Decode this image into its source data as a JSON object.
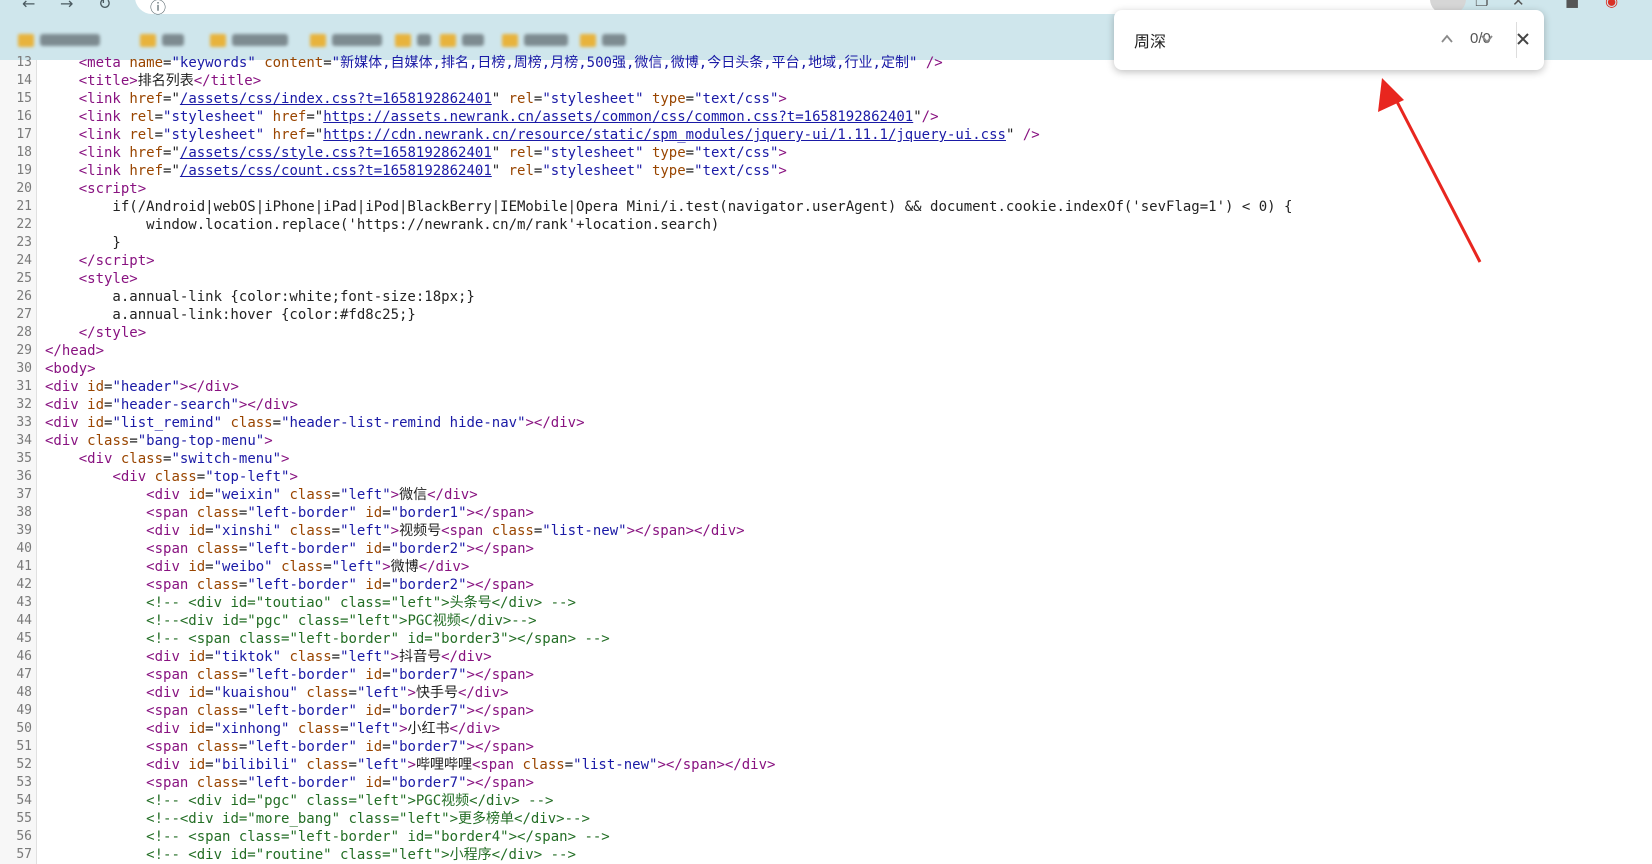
{
  "find_bar": {
    "query": "周深",
    "match_count": "0/0"
  },
  "icons": {
    "find_prev": "chevron-up-icon",
    "find_next": "chevron-down-icon",
    "find_close": "close-icon"
  },
  "code_lines": [
    {
      "n": "13",
      "html": "    <span class=\"tag\">&lt;meta</span> <span class=\"attr\">name</span>=<span class=\"val\">\"keywords\"</span> <span class=\"attr\">content</span>=<span class=\"val\">\"新媒体,自媒体,排名,日榜,周榜,月榜,500强,微信,微博,今日头条,平台,地域,行业,定制\"</span> <span class=\"tag\">/&gt;</span>"
    },
    {
      "n": "14",
      "html": "    <span class=\"tag\">&lt;title&gt;</span>排名列表<span class=\"tag\">&lt;/title&gt;</span>"
    },
    {
      "n": "15",
      "html": "    <span class=\"tag\">&lt;link</span> <span class=\"attr\">href</span>=\"<span class=\"link\">/assets/css/index.css?t=1658192862401</span>\" <span class=\"attr\">rel</span>=<span class=\"val\">\"stylesheet\"</span> <span class=\"attr\">type</span>=<span class=\"val\">\"text/css\"</span><span class=\"tag\">&gt;</span>"
    },
    {
      "n": "16",
      "html": "    <span class=\"tag\">&lt;link</span> <span class=\"attr\">rel</span>=<span class=\"val\">\"stylesheet\"</span> <span class=\"attr\">href</span>=\"<span class=\"link\">https://assets.newrank.cn/assets/common/css/common.css?t=1658192862401</span>\"<span class=\"tag\">/&gt;</span>"
    },
    {
      "n": "17",
      "html": "    <span class=\"tag\">&lt;link</span> <span class=\"attr\">rel</span>=<span class=\"val\">\"stylesheet\"</span> <span class=\"attr\">href</span>=\"<span class=\"link\">https://cdn.newrank.cn/resource/static/spm_modules/jquery-ui/1.11.1/jquery-ui.css</span>\" <span class=\"tag\">/&gt;</span>"
    },
    {
      "n": "18",
      "html": "    <span class=\"tag\">&lt;link</span> <span class=\"attr\">href</span>=\"<span class=\"link\">/assets/css/style.css?t=1658192862401</span>\" <span class=\"attr\">rel</span>=<span class=\"val\">\"stylesheet\"</span> <span class=\"attr\">type</span>=<span class=\"val\">\"text/css\"</span><span class=\"tag\">&gt;</span>"
    },
    {
      "n": "19",
      "html": "    <span class=\"tag\">&lt;link</span> <span class=\"attr\">href</span>=\"<span class=\"link\">/assets/css/count.css?t=1658192862401</span>\" <span class=\"attr\">rel</span>=<span class=\"val\">\"stylesheet\"</span> <span class=\"attr\">type</span>=<span class=\"val\">\"text/css\"</span><span class=\"tag\">&gt;</span>"
    },
    {
      "n": "20",
      "html": "    <span class=\"tag\">&lt;script&gt;</span>"
    },
    {
      "n": "21",
      "html": "        if(/Android|webOS|iPhone|iPad|iPod|BlackBerry|IEMobile|Opera Mini/i.test(navigator.userAgent) &amp;&amp; document.cookie.indexOf('sevFlag=1') &lt; 0) {"
    },
    {
      "n": "22",
      "html": "            window.location.replace('https://newrank.cn/m/rank'+location.search)"
    },
    {
      "n": "23",
      "html": "        }"
    },
    {
      "n": "24",
      "html": "    <span class=\"tag\">&lt;/script&gt;</span>"
    },
    {
      "n": "25",
      "html": "    <span class=\"tag\">&lt;style&gt;</span>"
    },
    {
      "n": "26",
      "html": "        a.annual-link {color:white;font-size:18px;}"
    },
    {
      "n": "27",
      "html": "        a.annual-link:hover {color:#fd8c25;}"
    },
    {
      "n": "28",
      "html": "    <span class=\"tag\">&lt;/style&gt;</span>"
    },
    {
      "n": "29",
      "html": "<span class=\"tag\">&lt;/head&gt;</span>"
    },
    {
      "n": "30",
      "html": "<span class=\"tag\">&lt;body&gt;</span>"
    },
    {
      "n": "31",
      "html": "<span class=\"tag\">&lt;div</span> <span class=\"attr\">id</span>=<span class=\"val\">\"header\"</span><span class=\"tag\">&gt;&lt;/div&gt;</span>"
    },
    {
      "n": "32",
      "html": "<span class=\"tag\">&lt;div</span> <span class=\"attr\">id</span>=<span class=\"val\">\"header-search\"</span><span class=\"tag\">&gt;&lt;/div&gt;</span>"
    },
    {
      "n": "33",
      "html": "<span class=\"tag\">&lt;div</span> <span class=\"attr\">id</span>=<span class=\"val\">\"list_remind\"</span> <span class=\"attr\">class</span>=<span class=\"val\">\"header-list-remind hide-nav\"</span><span class=\"tag\">&gt;&lt;/div&gt;</span>"
    },
    {
      "n": "34",
      "html": "<span class=\"tag\">&lt;div</span> <span class=\"attr\">class</span>=<span class=\"val\">\"bang-top-menu\"</span><span class=\"tag\">&gt;</span>"
    },
    {
      "n": "35",
      "html": "    <span class=\"tag\">&lt;div</span> <span class=\"attr\">class</span>=<span class=\"val\">\"switch-menu\"</span><span class=\"tag\">&gt;</span>"
    },
    {
      "n": "36",
      "html": "        <span class=\"tag\">&lt;div</span> <span class=\"attr\">class</span>=<span class=\"val\">\"top-left\"</span><span class=\"tag\">&gt;</span>"
    },
    {
      "n": "37",
      "html": "            <span class=\"tag\">&lt;div</span> <span class=\"attr\">id</span>=<span class=\"val\">\"weixin\"</span> <span class=\"attr\">class</span>=<span class=\"val\">\"left\"</span><span class=\"tag\">&gt;</span>微信<span class=\"tag\">&lt;/div&gt;</span>"
    },
    {
      "n": "38",
      "html": "            <span class=\"tag\">&lt;span</span> <span class=\"attr\">class</span>=<span class=\"val\">\"left-border\"</span> <span class=\"attr\">id</span>=<span class=\"val\">\"border1\"</span><span class=\"tag\">&gt;&lt;/span&gt;</span>"
    },
    {
      "n": "39",
      "html": "            <span class=\"tag\">&lt;div</span> <span class=\"attr\">id</span>=<span class=\"val\">\"xinshi\"</span> <span class=\"attr\">class</span>=<span class=\"val\">\"left\"</span><span class=\"tag\">&gt;</span>视频号<span class=\"tag\">&lt;span</span> <span class=\"attr\">class</span>=<span class=\"val\">\"list-new\"</span><span class=\"tag\">&gt;&lt;/span&gt;&lt;/div&gt;</span>"
    },
    {
      "n": "40",
      "html": "            <span class=\"tag\">&lt;span</span> <span class=\"attr\">class</span>=<span class=\"val\">\"left-border\"</span> <span class=\"attr\">id</span>=<span class=\"val\">\"border2\"</span><span class=\"tag\">&gt;&lt;/span&gt;</span>"
    },
    {
      "n": "41",
      "html": "            <span class=\"tag\">&lt;div</span> <span class=\"attr\">id</span>=<span class=\"val\">\"weibo\"</span> <span class=\"attr\">class</span>=<span class=\"val\">\"left\"</span><span class=\"tag\">&gt;</span>微博<span class=\"tag\">&lt;/div&gt;</span>"
    },
    {
      "n": "42",
      "html": "            <span class=\"tag\">&lt;span</span> <span class=\"attr\">class</span>=<span class=\"val\">\"left-border\"</span> <span class=\"attr\">id</span>=<span class=\"val\">\"border2\"</span><span class=\"tag\">&gt;&lt;/span&gt;</span>"
    },
    {
      "n": "43",
      "html": "            <span class=\"comment\">&lt;!-- &lt;div id=\"toutiao\" class=\"left\"&gt;头条号&lt;/div&gt; --&gt;</span>"
    },
    {
      "n": "44",
      "html": "            <span class=\"comment\">&lt;!--&lt;div id=\"pgc\" class=\"left\"&gt;PGC视频&lt;/div&gt;--&gt;</span>"
    },
    {
      "n": "45",
      "html": "            <span class=\"comment\">&lt;!-- &lt;span class=\"left-border\" id=\"border3\"&gt;&lt;/span&gt; --&gt;</span>"
    },
    {
      "n": "46",
      "html": "            <span class=\"tag\">&lt;div</span> <span class=\"attr\">id</span>=<span class=\"val\">\"tiktok\"</span> <span class=\"attr\">class</span>=<span class=\"val\">\"left\"</span><span class=\"tag\">&gt;</span>抖音号<span class=\"tag\">&lt;/div&gt;</span>"
    },
    {
      "n": "47",
      "html": "            <span class=\"tag\">&lt;span</span> <span class=\"attr\">class</span>=<span class=\"val\">\"left-border\"</span> <span class=\"attr\">id</span>=<span class=\"val\">\"border7\"</span><span class=\"tag\">&gt;&lt;/span&gt;</span>"
    },
    {
      "n": "48",
      "html": "            <span class=\"tag\">&lt;div</span> <span class=\"attr\">id</span>=<span class=\"val\">\"kuaishou\"</span> <span class=\"attr\">class</span>=<span class=\"val\">\"left\"</span><span class=\"tag\">&gt;</span>快手号<span class=\"tag\">&lt;/div&gt;</span>"
    },
    {
      "n": "49",
      "html": "            <span class=\"tag\">&lt;span</span> <span class=\"attr\">class</span>=<span class=\"val\">\"left-border\"</span> <span class=\"attr\">id</span>=<span class=\"val\">\"border7\"</span><span class=\"tag\">&gt;&lt;/span&gt;</span>"
    },
    {
      "n": "50",
      "html": "            <span class=\"tag\">&lt;div</span> <span class=\"attr\">id</span>=<span class=\"val\">\"xinhong\"</span> <span class=\"attr\">class</span>=<span class=\"val\">\"left\"</span><span class=\"tag\">&gt;</span>小红书<span class=\"tag\">&lt;/div&gt;</span>"
    },
    {
      "n": "51",
      "html": "            <span class=\"tag\">&lt;span</span> <span class=\"attr\">class</span>=<span class=\"val\">\"left-border\"</span> <span class=\"attr\">id</span>=<span class=\"val\">\"border7\"</span><span class=\"tag\">&gt;&lt;/span&gt;</span>"
    },
    {
      "n": "52",
      "html": "            <span class=\"tag\">&lt;div</span> <span class=\"attr\">id</span>=<span class=\"val\">\"bilibili\"</span> <span class=\"attr\">class</span>=<span class=\"val\">\"left\"</span><span class=\"tag\">&gt;</span>哔哩哔哩<span class=\"tag\">&lt;span</span> <span class=\"attr\">class</span>=<span class=\"val\">\"list-new\"</span><span class=\"tag\">&gt;&lt;/span&gt;&lt;/div&gt;</span>"
    },
    {
      "n": "53",
      "html": "            <span class=\"tag\">&lt;span</span> <span class=\"attr\">class</span>=<span class=\"val\">\"left-border\"</span> <span class=\"attr\">id</span>=<span class=\"val\">\"border7\"</span><span class=\"tag\">&gt;&lt;/span&gt;</span>"
    },
    {
      "n": "54",
      "html": "            <span class=\"comment\">&lt;!-- &lt;div id=\"pgc\" class=\"left\"&gt;PGC视频&lt;/div&gt; --&gt;</span>"
    },
    {
      "n": "55",
      "html": "            <span class=\"comment\">&lt;!--&lt;div id=\"more_bang\" class=\"left\"&gt;更多榜单&lt;/div&gt;--&gt;</span>"
    },
    {
      "n": "56",
      "html": "            <span class=\"comment\">&lt;!-- &lt;span class=\"left-border\" id=\"border4\"&gt;&lt;/span&gt; --&gt;</span>"
    },
    {
      "n": "57",
      "html": "            <span class=\"comment\">&lt;!-- &lt;div id=\"routine\" class=\"left\"&gt;小程序&lt;/div&gt; --&gt;</span>"
    }
  ]
}
